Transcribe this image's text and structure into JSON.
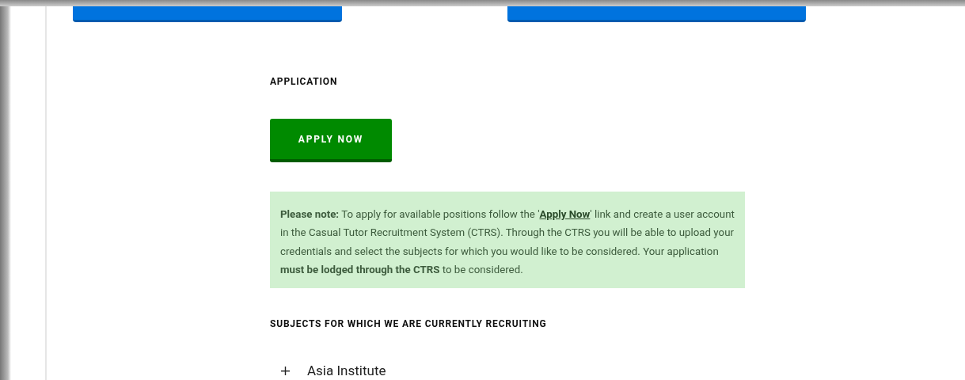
{
  "top_buttons": [
    {
      "kind": "button"
    },
    {
      "kind": "button"
    }
  ],
  "application": {
    "heading": "APPLICATION",
    "button": "APPLY NOW"
  },
  "note": {
    "before": "**Please note:** To apply for available positions follow the '",
    "link": "Apply Now",
    "after": "' link and create a user account in the Casual Tutor Recruitment System (CTRS). Through the CTRS you will be able to upload your credentials and select the subjects for which you would like to be considered. Your application **must be lodged through the CTRS** to be considered."
  },
  "subjects": {
    "heading": "SUBJECTS FOR WHICH WE ARE CURRENTLY RECRUITING",
    "items": [
      {
        "label": "Asia Institute",
        "expanded": false
      }
    ]
  }
}
